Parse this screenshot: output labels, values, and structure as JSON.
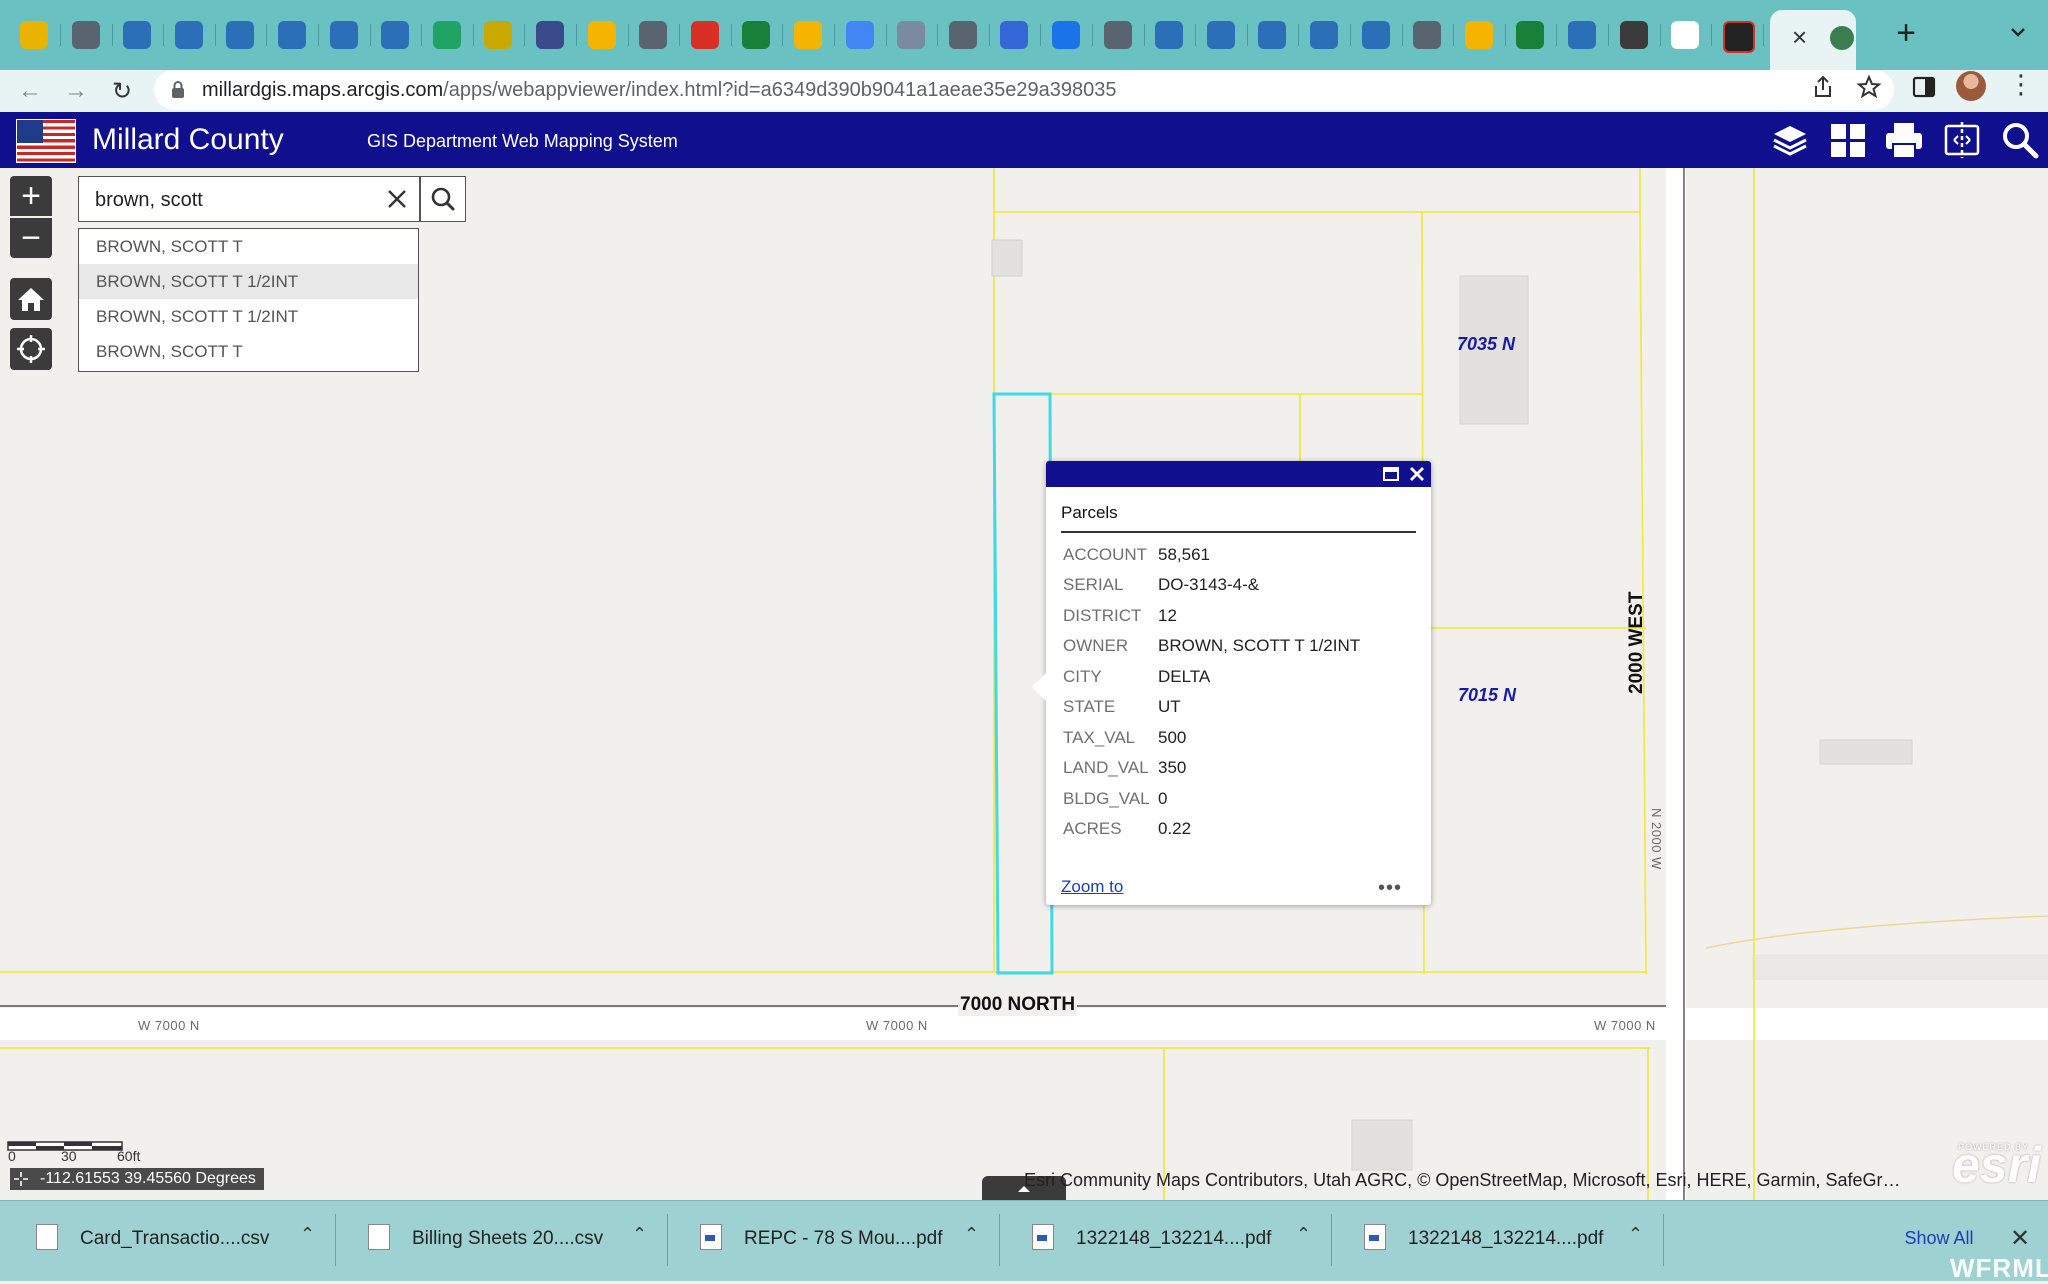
{
  "browser": {
    "url_host": "millardgis.maps.arcgis.com",
    "url_path": "/apps/webappviewer/index.html?id=a6349d390b9041a1aeae35e29a398035",
    "tab_count_visible": 35,
    "active_tab_close": "×",
    "new_tab": "+"
  },
  "app": {
    "title": "Millard County",
    "subtitle": "GIS Department Web Mapping System",
    "header_icons": [
      "layers-icon",
      "basemap-gallery-icon",
      "print-icon",
      "swipe-icon",
      "search-icon"
    ],
    "header_color": "#10108e"
  },
  "search": {
    "value": "brown, scott",
    "suggestions": [
      "BROWN, SCOTT T",
      "BROWN, SCOTT T 1/2INT",
      "BROWN, SCOTT T 1/2INT",
      "BROWN, SCOTT T"
    ],
    "highlighted_index": 1
  },
  "map": {
    "road_main": "7000 NORTH",
    "road_small": [
      "W 7000 N",
      "W 7000 N",
      "W 7000 N"
    ],
    "road_west": "2000 WEST",
    "road_west_small": "N 2000 W",
    "addresses": [
      "7035 N",
      "7015 N"
    ],
    "parcel_line_color": "#f2e84a",
    "selected_parcel_color": "#3fd9e8"
  },
  "popup": {
    "title": "Parcels",
    "attributes": [
      {
        "key": "ACCOUNT",
        "value": "58,561"
      },
      {
        "key": "SERIAL",
        "value": "DO-3143-4-&"
      },
      {
        "key": "DISTRICT",
        "value": "12"
      },
      {
        "key": "OWNER",
        "value": "BROWN, SCOTT T 1/2INT"
      },
      {
        "key": "CITY",
        "value": "DELTA"
      },
      {
        "key": "STATE",
        "value": "UT"
      },
      {
        "key": "TAX_VAL",
        "value": "500"
      },
      {
        "key": "LAND_VAL",
        "value": "350"
      },
      {
        "key": "BLDG_VAL",
        "value": "0"
      },
      {
        "key": "ACRES",
        "value": "0.22"
      }
    ],
    "zoom_to": "Zoom to",
    "more": "•••"
  },
  "scale": {
    "labels": [
      "0",
      "30",
      "60ft"
    ]
  },
  "coords": "-112.61553 39.45560 Degrees",
  "attribution": "Esri Community Maps Contributors, Utah AGRC, © OpenStreetMap, Microsoft, Esri, HERE, Garmin, SafeGr…",
  "esri": {
    "small": "POWERED BY",
    "logo": "esri"
  },
  "downloads": [
    {
      "name": "Card_Transactio....csv",
      "type": "csv"
    },
    {
      "name": "Billing Sheets 20....csv",
      "type": "csv"
    },
    {
      "name": "REPC - 78 S Mou....pdf",
      "type": "pdf"
    },
    {
      "name": "1322148_132214....pdf",
      "type": "pdf"
    },
    {
      "name": "1322148_132214....pdf",
      "type": "pdf"
    }
  ],
  "show_all": "Show All",
  "watermark": "WFRMLS"
}
